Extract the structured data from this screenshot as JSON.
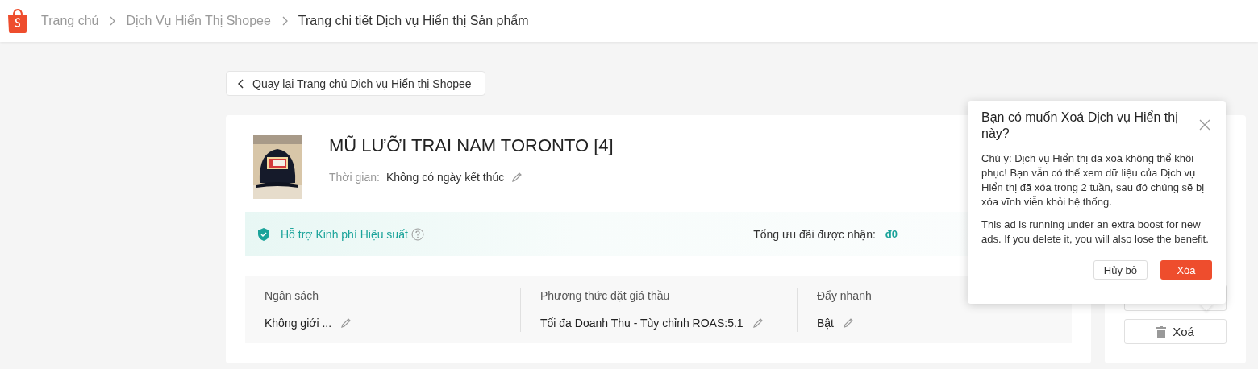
{
  "breadcrumb": [
    {
      "label": "Trang chủ",
      "current": false
    },
    {
      "label": "Dịch Vụ Hiển Thị Shopee",
      "current": false
    },
    {
      "label": "Trang chi tiết Dịch vụ Hiển thị Sản phẩm",
      "current": true
    }
  ],
  "back_button": "Quay lại Trang chủ Dịch vụ Hiển thị Shopee",
  "product": {
    "title": "MŨ LƯỠI TRAI NAM TORONTO [4]",
    "time_label": "Thời gian:",
    "time_value": "Không có ngày kết thúc"
  },
  "support": {
    "label": "Hỗ trợ Kinh phí Hiệu suất",
    "total_label": "Tổng ưu đãi được nhận:",
    "total_value": "đ0"
  },
  "stats": [
    {
      "label": "Ngân sách",
      "value": "Không giới ..."
    },
    {
      "label": "Phương thức đặt giá thầu",
      "value": "Tối đa Doanh Thu - Tùy chỉnh ROAS:5.1"
    },
    {
      "label": "Đẩy nhanh",
      "value": "Bật"
    }
  ],
  "side_button": "Xoá",
  "popover": {
    "title": "Bạn có muốn Xoá Dịch vụ Hiển thị này?",
    "paragraphs": [
      "Chú ý: Dịch vụ Hiển thị đã xoá không thể khôi phục! Bạn vẫn có thể xem dữ liệu của Dịch vụ Hiển thị đã xóa trong 2 tuần, sau đó chúng sẽ bị xóa vĩnh viễn khỏi hệ thống.",
      "This ad is running under an extra boost for new ads. If you delete it, you will also lose the benefit."
    ],
    "cancel": "Hủy bỏ",
    "confirm": "Xóa"
  }
}
